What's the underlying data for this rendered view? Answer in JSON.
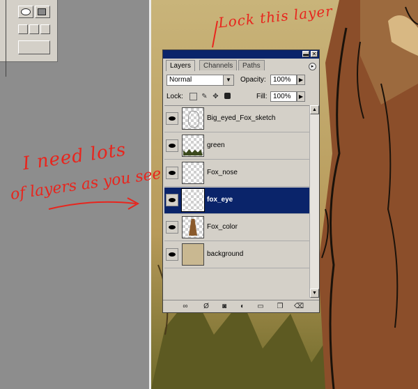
{
  "annotations": {
    "lock_note": "Lock this layer",
    "need_line1": "I need lots",
    "need_line2": "of layers as you see"
  },
  "panel": {
    "tabs": [
      {
        "label": "Layers",
        "active": true
      },
      {
        "label": "Channels",
        "active": false
      },
      {
        "label": "Paths",
        "active": false
      }
    ],
    "blend_mode": "Normal",
    "opacity_label": "Opacity:",
    "opacity": "100%",
    "lock_label": "Lock:",
    "fill_label": "Fill:",
    "fill": "100%",
    "layers": [
      {
        "name": "Big_eyed_Fox_sketch",
        "visible": true,
        "selected": false
      },
      {
        "name": "green",
        "visible": true,
        "selected": false
      },
      {
        "name": "Fox_nose",
        "visible": true,
        "selected": false
      },
      {
        "name": "fox_eye",
        "visible": true,
        "selected": true
      },
      {
        "name": "Fox_color",
        "visible": true,
        "selected": false
      },
      {
        "name": "background",
        "visible": true,
        "selected": false
      }
    ]
  },
  "colors": {
    "title_bar": "#0a246a",
    "selection": "#0a246a",
    "annotation": "#e8251d",
    "panel_bg": "#d4d0c8"
  },
  "icons": [
    "minimize-icon",
    "close-icon",
    "palette-menu-icon",
    "lock-transparency-icon",
    "lock-paint-icon",
    "lock-move-icon",
    "lock-all-icon",
    "eye-icon",
    "link-icon",
    "fx-icon",
    "mask-icon",
    "adjustment-icon",
    "folder-icon",
    "new-layer-icon",
    "trash-icon"
  ]
}
